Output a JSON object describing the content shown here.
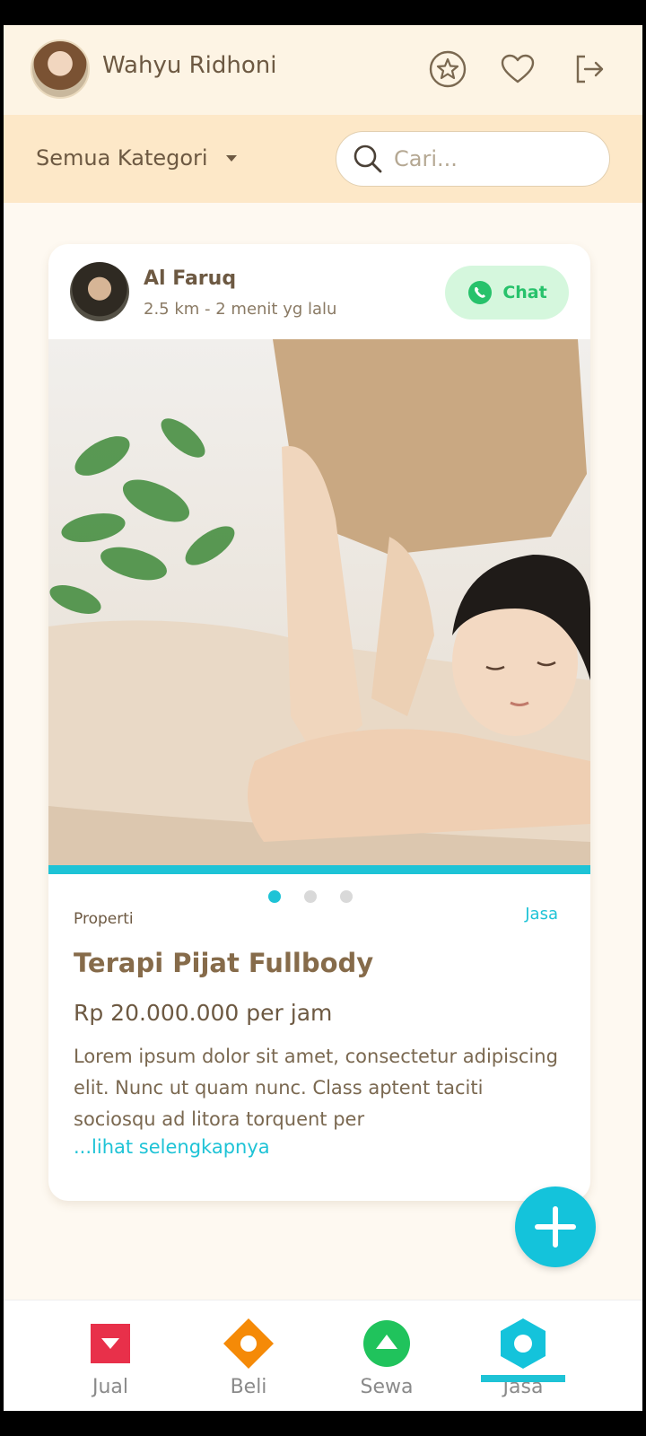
{
  "header": {
    "user_name": "Wahyu Ridhoni",
    "icons": [
      "star-icon",
      "heart-icon",
      "logout-icon"
    ]
  },
  "filter": {
    "category_label": "Semua Kategori",
    "search_placeholder": "Cari..."
  },
  "post": {
    "seller_name": "Al Faruq",
    "seller_meta": "2.5 km  - 2 menit yg lalu",
    "chat_label": "Chat",
    "category": "Properti",
    "type": "Jasa",
    "title": "Terapi Pijat Fullbody",
    "price": "Rp 20.000.000 per jam",
    "description": "Lorem ipsum dolor sit amet, consectetur adipiscing elit. Nunc ut quam nunc. Class aptent taciti sociosqu ad litora torquent per",
    "more_link": "...lihat selengkapnya",
    "carousel": {
      "total": 3,
      "active": 1
    }
  },
  "bottom_nav": {
    "items": [
      {
        "label": "Jual",
        "color": "#e8304a"
      },
      {
        "label": "Beli",
        "color": "#f58a07"
      },
      {
        "label": "Sewa",
        "color": "#20c35c"
      },
      {
        "label": "Jasa",
        "color": "#14c3db"
      }
    ],
    "active": "Jasa"
  },
  "colors": {
    "accent": "#1ec3d6",
    "whatsapp": "#27c26b"
  }
}
